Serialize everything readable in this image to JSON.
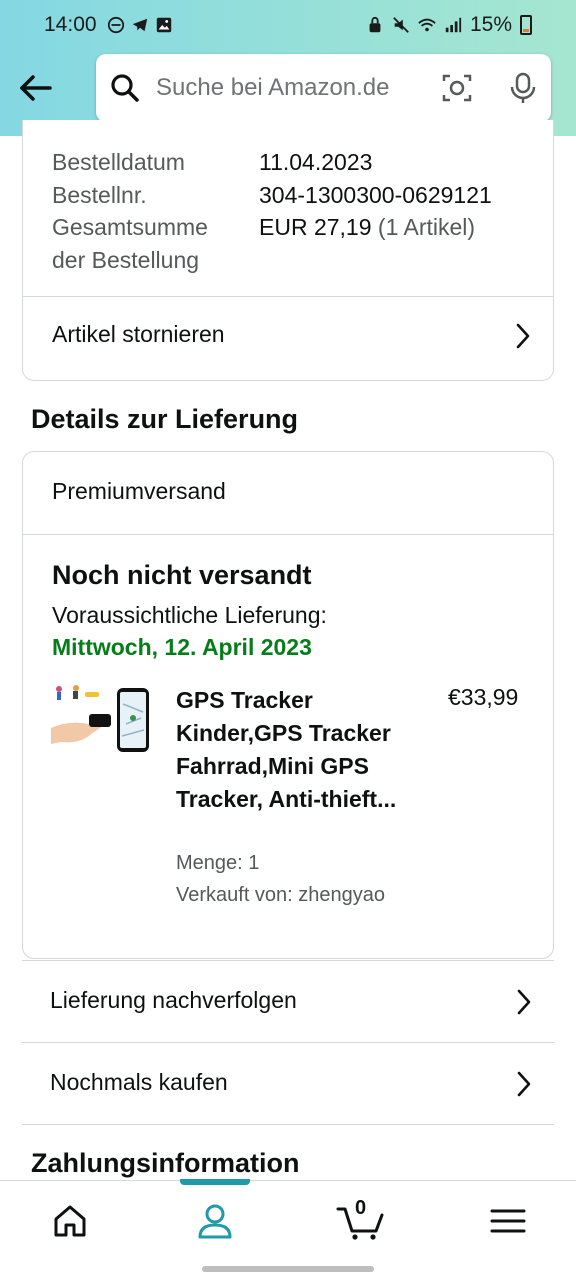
{
  "status_bar": {
    "time": "14:00",
    "battery": "15%",
    "icons": [
      "dnd-icon",
      "telegram-icon",
      "gallery-icon",
      "lock-icon",
      "mute-icon",
      "wifi-icon",
      "signal-icon"
    ]
  },
  "header": {
    "search_placeholder": "Suche bei Amazon.de"
  },
  "order": {
    "date_label": "Bestelldatum",
    "date_value": "11.04.2023",
    "number_label": "Bestellnr.",
    "number_value": "304-1300300-0629121",
    "total_label_1": "Gesamtsumme",
    "total_label_2": "der Bestellung",
    "total_value": "EUR 27,19",
    "total_items": "(1 Artikel)",
    "cancel_label": "Artikel stornieren"
  },
  "delivery": {
    "section_title": "Details zur Lieferung",
    "shipping_method": "Premiumversand",
    "status": "Noch nicht versandt",
    "expected_label": "Voraussichtliche Lieferung:",
    "expected_date": "Mittwoch, 12. April 2023",
    "item": {
      "title": "GPS Tracker Kinder,GPS Tracker Fahrrad,Mini GPS Tracker, Anti-thieft...",
      "price": "€33,99",
      "quantity": "Menge: 1",
      "seller": "Verkauft von: zhengyao"
    },
    "track_label": "Lieferung nachverfolgen",
    "buy_again_label": "Nochmals kaufen"
  },
  "payment": {
    "section_title": "Zahlungsinformation"
  },
  "bottom_nav": {
    "cart_count": "0",
    "active_tab": "account",
    "accent_color": "#1f9aa8"
  }
}
